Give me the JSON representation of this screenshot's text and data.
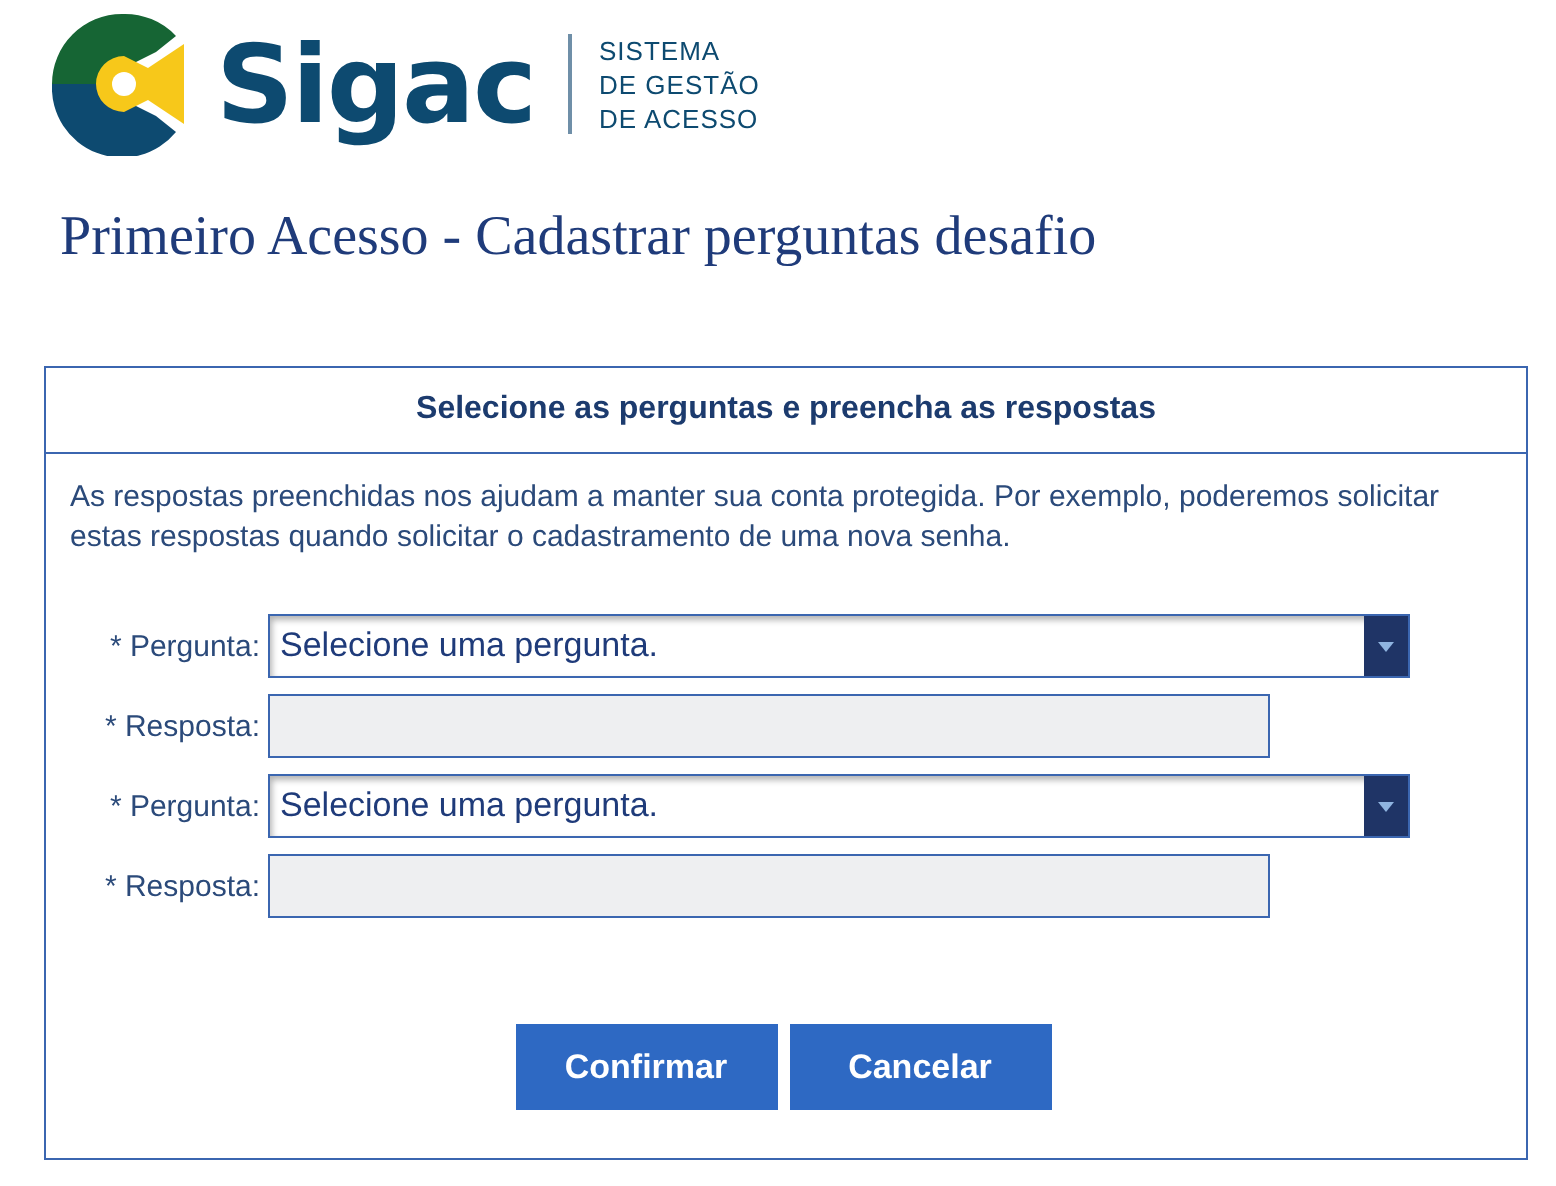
{
  "logo": {
    "name": "Sigac",
    "tagline": [
      "SISTEMA",
      "DE GESTÃO",
      "DE ACESSO"
    ]
  },
  "page_title": "Primeiro Acesso - Cadastrar perguntas desafio",
  "panel": {
    "heading": "Selecione as perguntas e preencha as respostas",
    "intro": "As respostas preenchidas nos ajudam a manter sua conta protegida. Por exemplo, poderemos solicitar estas respostas quando solicitar o cadastramento de uma nova senha.",
    "fields": [
      {
        "kind": "select",
        "label": "* Pergunta:",
        "value": "Selecione uma pergunta.",
        "disabled": false
      },
      {
        "kind": "text",
        "label": "* Resposta:",
        "disabled": true
      },
      {
        "kind": "select",
        "label": "* Pergunta:",
        "value": "Selecione uma pergunta.",
        "disabled": false
      },
      {
        "kind": "text",
        "label": "* Resposta:",
        "disabled": true
      }
    ],
    "buttons": [
      "Confirmar",
      "Cancelar"
    ]
  }
}
